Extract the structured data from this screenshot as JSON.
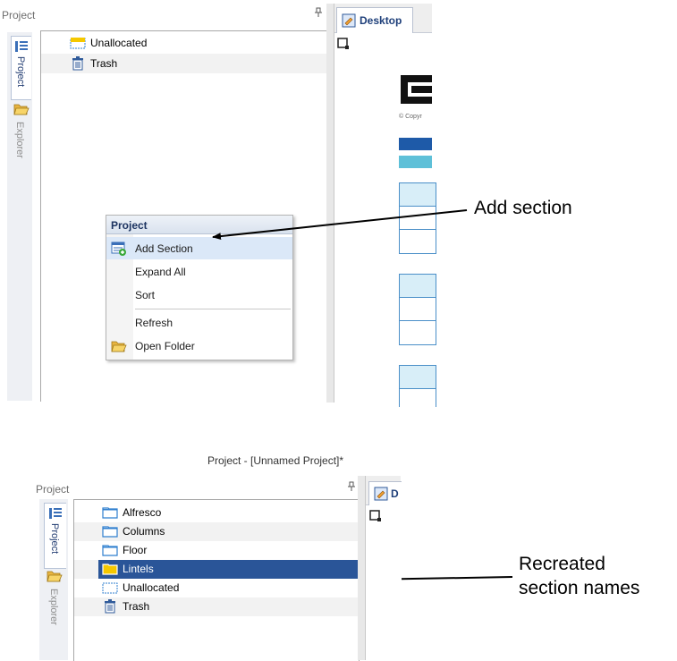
{
  "top": {
    "panel_title": "Project",
    "pin_icon": "pin-icon",
    "side_tabs": [
      "Project",
      "Explorer"
    ],
    "tree_items": [
      {
        "label": "Unallocated",
        "icon": "unallocated-folder-icon"
      },
      {
        "label": "Trash",
        "icon": "trash-icon"
      }
    ],
    "document_tab": "Desktop",
    "copyright_text": "© Copyr",
    "context_menu": {
      "header": "Project",
      "items": [
        {
          "label": "Add Section",
          "icon": "add-section-icon",
          "highlighted": true
        },
        {
          "label": "Expand All",
          "icon": ""
        },
        {
          "label": "Sort",
          "icon": ""
        },
        {
          "label": "Refresh",
          "icon": ""
        },
        {
          "label": "Open Folder",
          "icon": "open-folder-icon"
        }
      ]
    },
    "callout": "Add section"
  },
  "bottom": {
    "window_title": "Project - [Unnamed Project]*",
    "panel_title": "Project",
    "side_tabs": [
      "Project",
      "Explorer"
    ],
    "tree_items": [
      {
        "label": "Alfresco",
        "icon": "folder-icon",
        "selected": false
      },
      {
        "label": "Columns",
        "icon": "folder-icon",
        "selected": false
      },
      {
        "label": "Floor",
        "icon": "folder-icon",
        "selected": false
      },
      {
        "label": "Lintels",
        "icon": "folder-icon",
        "selected": true
      },
      {
        "label": "Unallocated",
        "icon": "unallocated-folder-icon",
        "selected": false
      },
      {
        "label": "Trash",
        "icon": "trash-icon",
        "selected": false
      }
    ],
    "document_tab": "D",
    "callout_line1": "Recreated",
    "callout_line2": "section names"
  },
  "colors": {
    "selection": "#2a5598",
    "menu_highlight": "#dbe8f8",
    "accent_blue": "#1e5aa8",
    "accent_cyan": "#5ec0d8",
    "folder_blue": "#2f7fcf",
    "folder_yellow": "#f5c800"
  }
}
